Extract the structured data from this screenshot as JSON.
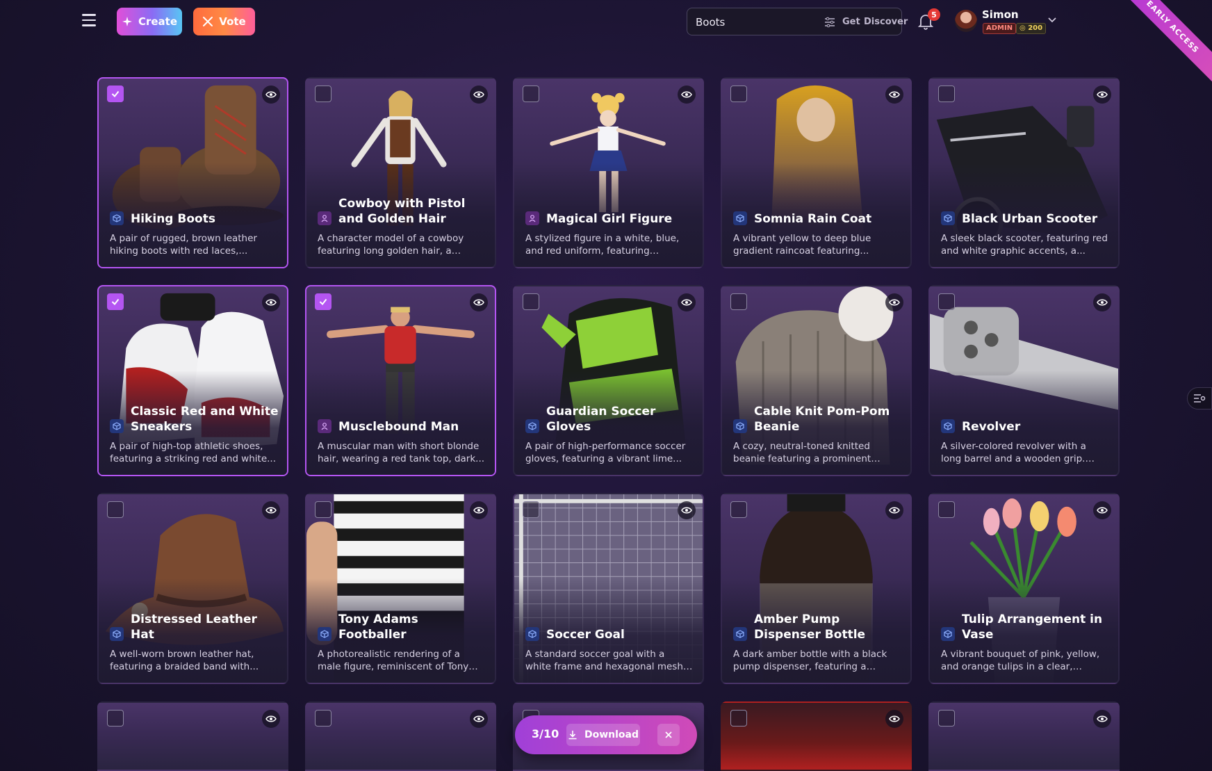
{
  "header": {
    "create_label": "Create",
    "vote_label": "Vote",
    "search_value": "Boots",
    "get_label": "Get",
    "discover_label": "Discover",
    "notifications_count": "5",
    "user_name": "Simon",
    "role_badge": "ADMIN",
    "credits": "200",
    "ribbon": "EARLY ACCESS"
  },
  "cards": [
    {
      "title": "Hiking Boots",
      "desc": "A pair of rugged, brown leather hiking boots with red laces,...",
      "type_icon": "cube-icon",
      "selected": true
    },
    {
      "title": "Cowboy with Pistol and Golden Hair",
      "desc": "A character model of a cowboy featuring long golden hair, a brow...",
      "type_icon": "person-icon",
      "selected": false
    },
    {
      "title": "Magical Girl Figure",
      "desc": "A stylized figure in a white, blue, and red uniform, featuring golden...",
      "type_icon": "person-icon",
      "selected": false
    },
    {
      "title": "Somnia Rain Coat",
      "desc": "A vibrant yellow to deep blue gradient raincoat featuring...",
      "type_icon": "cube-icon",
      "selected": false
    },
    {
      "title": "Black Urban Scooter",
      "desc": "A sleek black scooter, featuring red and white graphic accents, a...",
      "type_icon": "cube-icon",
      "selected": false
    },
    {
      "title": "Classic Red and White Sneakers",
      "desc": "A pair of high-top athletic shoes, featuring a striking red and white...",
      "type_icon": "cube-icon",
      "selected": true
    },
    {
      "title": "Musclebound Man",
      "desc": "A muscular man with short blonde hair, wearing a red tank top, dark...",
      "type_icon": "person-icon",
      "selected": true
    },
    {
      "title": "Guardian Soccer Gloves",
      "desc": "A pair of high-performance soccer gloves, featuring a vibrant lime...",
      "type_icon": "cube-icon",
      "selected": false
    },
    {
      "title": "Cable Knit Pom-Pom Beanie",
      "desc": "A cozy, neutral-toned knitted beanie featuring a prominent cabl...",
      "type_icon": "cube-icon",
      "selected": false
    },
    {
      "title": "Revolver",
      "desc": "A silver-colored revolver with a long barrel and a wooden grip. The...",
      "type_icon": "cube-icon",
      "selected": false
    },
    {
      "title": "Distressed Leather Hat",
      "desc": "A well-worn brown leather hat, featuring a braided band with...",
      "type_icon": "cube-icon",
      "selected": false
    },
    {
      "title": "Tony Adams Footballer",
      "desc": "A photorealistic rendering of a male figure, reminiscent of Tony Adams,...",
      "type_icon": "cube-icon",
      "selected": false
    },
    {
      "title": "Soccer Goal",
      "desc": "A standard soccer goal with a white frame and hexagonal mesh net,...",
      "type_icon": "cube-icon",
      "selected": false
    },
    {
      "title": "Amber Pump Dispenser Bottle",
      "desc": "A dark amber bottle with a black pump dispenser, featuring a white...",
      "type_icon": "cube-icon",
      "selected": false
    },
    {
      "title": "Tulip Arrangement in Vase",
      "desc": "A vibrant bouquet of pink, yellow, and orange tulips in a clear, facete...",
      "type_icon": "cube-icon",
      "selected": false
    }
  ],
  "selection": {
    "count": "3/10",
    "download_label": "Download"
  }
}
